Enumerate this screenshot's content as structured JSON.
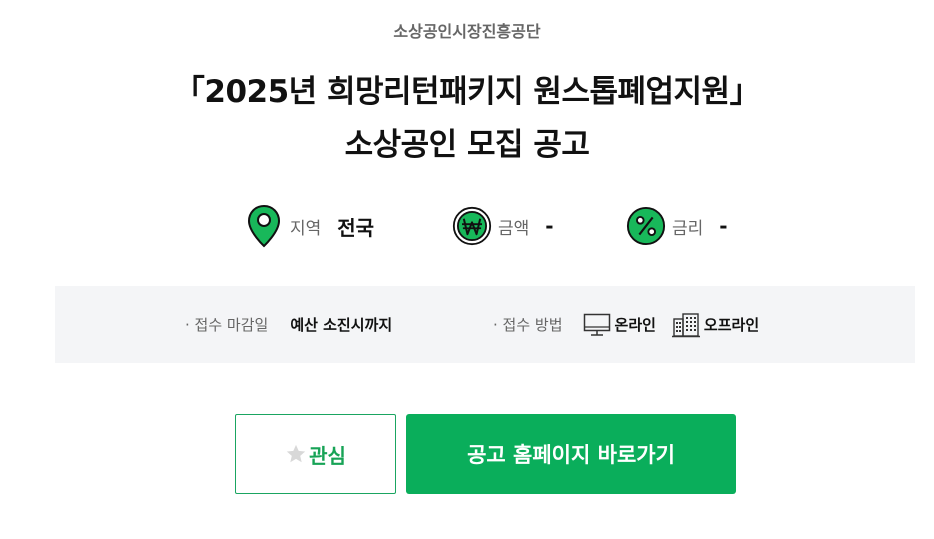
{
  "header": {
    "organization": "소상공인시장진흥공단",
    "title_line1": "「2025년 희망리턴패키지 원스톱폐업지원」",
    "title_line2": "소상공인 모집 공고"
  },
  "summary": {
    "region": {
      "icon": "map-pin-icon",
      "label": "지역",
      "value": "전국"
    },
    "amount": {
      "icon": "won-icon",
      "label": "금액",
      "value": "-"
    },
    "rate": {
      "icon": "percent-icon",
      "label": "금리",
      "value": "-"
    }
  },
  "details": {
    "deadline_label": "· 접수 마감일",
    "deadline_value": "예산 소진시까지",
    "method_label": "· 접수 방법",
    "methods": [
      {
        "icon": "monitor-icon",
        "label": "온라인"
      },
      {
        "icon": "building-icon",
        "label": "오프라인"
      }
    ]
  },
  "actions": {
    "favorite_label": "관심",
    "homepage_label": "공고 홈페이지 바로가기"
  },
  "colors": {
    "accent": "#0aae5b",
    "icon_green": "#18b85a",
    "panel_bg": "#f4f5f7"
  }
}
